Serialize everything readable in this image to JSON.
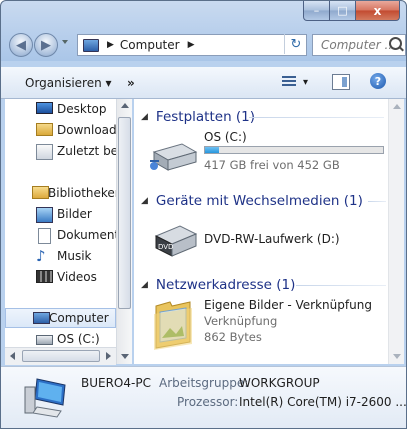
{
  "window": {
    "caption_buttons": {
      "minimize": "–",
      "maximize": "□",
      "close": "x"
    }
  },
  "nav": {
    "back_glyph": "◀",
    "forward_glyph": "▶",
    "address_crumb": "Computer",
    "address_arrow": "▶",
    "address_arrow_end": "▶",
    "refresh_glyph": "↻",
    "search_placeholder": "Computer ..."
  },
  "toolbar": {
    "organize_label": "Organisieren ▾",
    "more_label": "»",
    "view_dropdown": "▾",
    "help_label": "?"
  },
  "sidebar": {
    "items": [
      {
        "label": "Desktop",
        "icon": "desktop-icon"
      },
      {
        "label": "Downloads",
        "icon": "downloads-icon"
      },
      {
        "label": "Zuletzt bes",
        "icon": "recent-places-icon"
      },
      {
        "label": "Bibliotheken",
        "icon": "libraries-icon"
      },
      {
        "label": "Bilder",
        "icon": "pictures-icon"
      },
      {
        "label": "Dokumente",
        "icon": "documents-icon"
      },
      {
        "label": "Musik",
        "icon": "music-icon"
      },
      {
        "label": "Videos",
        "icon": "videos-icon"
      },
      {
        "label": "Computer",
        "icon": "computer-icon"
      },
      {
        "label": "OS (C:)",
        "icon": "drive-icon"
      }
    ]
  },
  "groups": {
    "drives": {
      "header": "Festplatten (1)",
      "item": {
        "name": "OS (C:)",
        "detail": "417 GB frei von 452 GB",
        "used_fraction": 0.077,
        "icon": "hard-drive-icon"
      }
    },
    "removable": {
      "header": "Geräte mit Wechselmedien (1)",
      "item": {
        "name": "DVD-RW-Laufwerk (D:)",
        "icon": "dvd-drive-icon",
        "badge": "DVD"
      }
    },
    "network": {
      "header": "Netzwerkadresse (1)",
      "item": {
        "name": "Eigene Bilder - Verknüpfung",
        "type": "Verknüpfung",
        "size": "862 Bytes",
        "icon": "shortcut-folder-icon"
      }
    }
  },
  "details": {
    "computer_name": "BUERO4-PC",
    "workgroup_label": "Arbeitsgruppe:",
    "workgroup_value": "WORKGROUP",
    "processor_label": "Prozessor:",
    "processor_value": "Intel(R) Core(TM) i7-2600 ..."
  },
  "colors": {
    "group_header": "#1e3287",
    "bar_fill": "#2796dd",
    "selection": "#dbe8f8"
  }
}
